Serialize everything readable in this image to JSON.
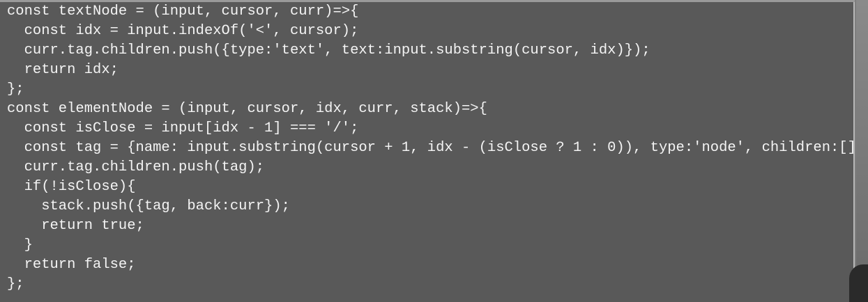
{
  "editor": {
    "lines": [
      "const textNode = (input, cursor, curr)=>{",
      "  const idx = input.indexOf('<', cursor);",
      "  curr.tag.children.push({type:'text', text:input.substring(cursor, idx)});",
      "  return idx;",
      "};",
      "const elementNode = (input, cursor, idx, curr, stack)=>{",
      "  const isClose = input[idx - 1] === '/';",
      "  const tag = {name: input.substring(cursor + 1, idx - (isClose ? 1 : 0)), type:'node', children:[]};",
      "  curr.tag.children.push(tag);",
      "  if(!isClose){",
      "    stack.push({tag, back:curr});",
      "    return true;",
      "  }",
      "  return false;",
      "};"
    ]
  }
}
